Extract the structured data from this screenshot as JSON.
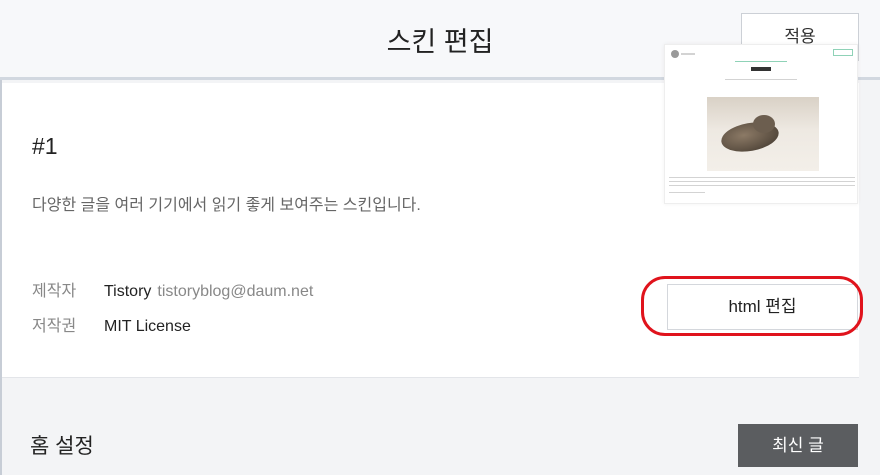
{
  "header": {
    "title": "스킨 편집",
    "apply_label": "적용"
  },
  "skin": {
    "name": "#1",
    "description": "다양한 글을 여러 기기에서 읽기 좋게 보여주는 스킨입니다.",
    "author_label": "제작자",
    "author_name": "Tistory",
    "author_email": "tistoryblog@daum.net",
    "license_label": "저작권",
    "license_value": "MIT License",
    "html_edit_label": "html 편집"
  },
  "home": {
    "title": "홈 설정",
    "latest_label": "최신 글"
  },
  "colors": {
    "highlight": "#e0131c",
    "accent_button": "#5b5d60"
  }
}
